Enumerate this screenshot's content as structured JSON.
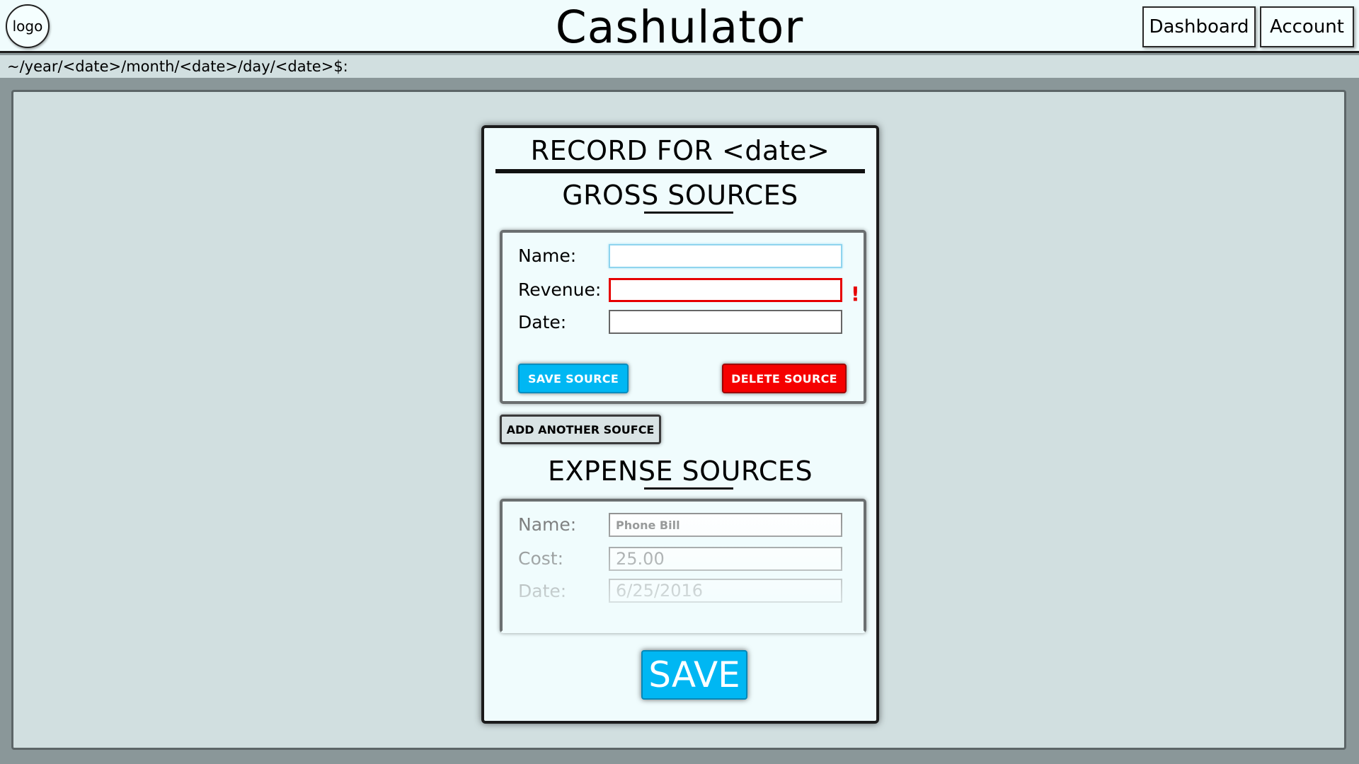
{
  "header": {
    "logo_text": "logo",
    "app_title": "Cashulator",
    "nav": {
      "dashboard": "Dashboard",
      "account": "Account"
    }
  },
  "breadcrumb": "~/year/<date>/month/<date>/day/<date>$:",
  "record": {
    "title": "RECORD FOR <date>",
    "gross": {
      "title": "GROSS SOURCES",
      "fields": {
        "name_label": "Name:",
        "revenue_label": "Revenue:",
        "date_label": "Date:",
        "name_value": "",
        "revenue_value": "",
        "date_value": ""
      },
      "error_mark": "!",
      "save_label": "SAVE SOURCE",
      "delete_label": "DELETE SOURCE"
    },
    "add_another_label": "ADD ANOTHER SOUFCE",
    "expense": {
      "title": "EXPENSE SOURCES",
      "fields": {
        "name_label": "Name:",
        "cost_label": "Cost:",
        "date_label": "Date:",
        "name_value": "Phone Bill",
        "cost_value": "25.00",
        "date_value": "6/25/2016"
      }
    },
    "save_label": "SAVE"
  },
  "colors": {
    "accent_blue": "#00b7f3",
    "danger_red": "#f50000",
    "error_border": "#e60000",
    "panel_bg": "#f0fcfd",
    "page_bg": "#d1dfe0"
  }
}
